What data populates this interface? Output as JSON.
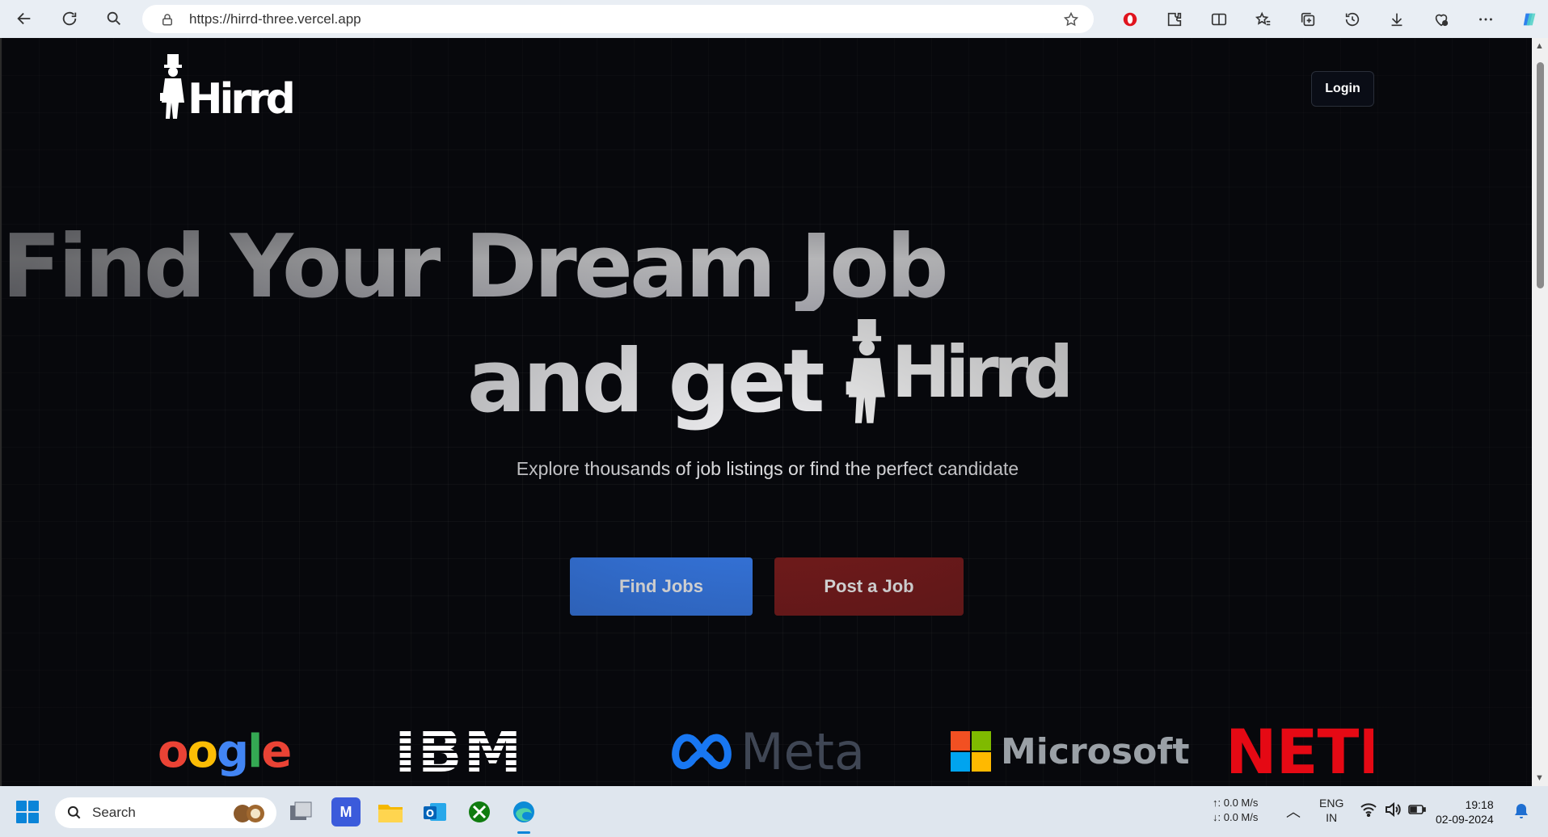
{
  "browser": {
    "url": "https://hirrd-three.vercel.app"
  },
  "site": {
    "logo_text": "Hirrd",
    "login_label": "Login",
    "headline_line1": "Find Your Dream Job",
    "headline_line2": "and get",
    "subtitle": "Explore thousands of job listings or find the perfect candidate",
    "find_jobs_label": "Find Jobs",
    "post_job_label": "Post a Job",
    "companies": {
      "google": "oogle",
      "ibm": "IBM",
      "meta": "Meta",
      "microsoft": "Microsoft",
      "netflix": "NETFL"
    },
    "colors": {
      "find_jobs_bg": "#3b82f6",
      "post_job_bg": "#7f1d1d",
      "netflix": "#e50914"
    }
  },
  "taskbar": {
    "search_label": "Search",
    "net_up": "0.0 M/s",
    "net_down": "0.0 M/s",
    "lang": "ENG",
    "region": "IN",
    "time": "19:18",
    "date": "02-09-2024"
  }
}
